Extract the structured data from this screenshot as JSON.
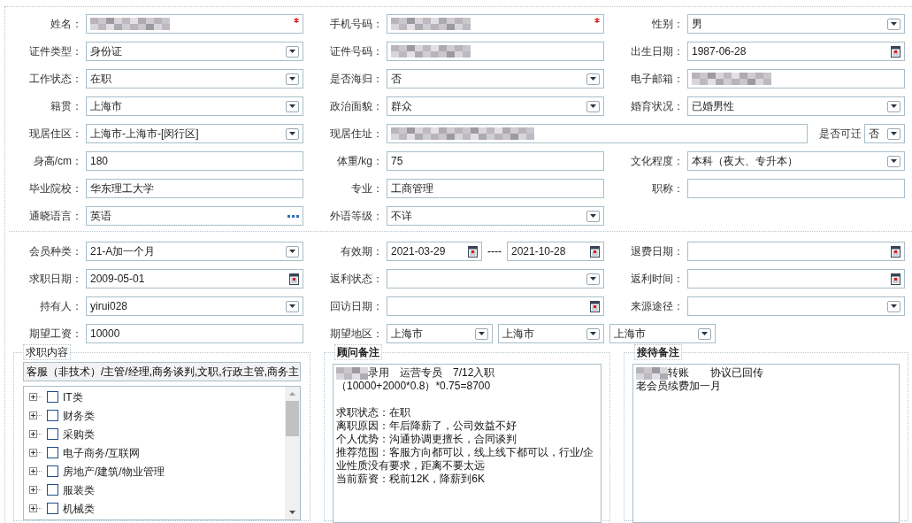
{
  "personal": {
    "rows": [
      {
        "fields": [
          {
            "label": "姓名：",
            "kind": "text",
            "redacted": true,
            "required": true
          },
          {
            "label": "手机号码：",
            "kind": "text",
            "redacted": true,
            "required": true
          },
          {
            "label": "性别：",
            "kind": "select",
            "value": "男"
          }
        ]
      },
      {
        "fields": [
          {
            "label": "证件类型：",
            "kind": "select",
            "value": "身份证"
          },
          {
            "label": "证件号码：",
            "kind": "text",
            "redacted": true
          },
          {
            "label": "出生日期：",
            "kind": "date",
            "value": "1987-06-28"
          }
        ]
      },
      {
        "fields": [
          {
            "label": "工作状态：",
            "kind": "select",
            "value": "在职"
          },
          {
            "label": "是否海归：",
            "kind": "select",
            "value": "否"
          },
          {
            "label": "电子邮箱：",
            "kind": "text",
            "redacted": true
          }
        ]
      },
      {
        "fields": [
          {
            "label": "籍贯：",
            "kind": "select",
            "value": "上海市"
          },
          {
            "label": "政治面貌：",
            "kind": "select",
            "value": "群众"
          },
          {
            "label": "婚育状况：",
            "kind": "select",
            "value": "已婚男性"
          }
        ]
      },
      {
        "fields": [
          {
            "label": "现居住区：",
            "kind": "select",
            "value": " 上海市-上海市-[闵行区]"
          },
          {
            "label": "现居住址：",
            "kind": "text",
            "redacted": true,
            "wide": true,
            "extra": {
              "label": "是否可迁",
              "value": "否"
            }
          }
        ]
      },
      {
        "fields": [
          {
            "label": "身高/cm：",
            "kind": "text",
            "value": "180"
          },
          {
            "label": "体重/kg：",
            "kind": "text",
            "value": "75"
          },
          {
            "label": "文化程度：",
            "kind": "select",
            "value": "本科（夜大、专升本）"
          }
        ]
      },
      {
        "fields": [
          {
            "label": "毕业院校：",
            "kind": "text",
            "value": "华东理工大学"
          },
          {
            "label": "专业：",
            "kind": "text",
            "value": "工商管理"
          },
          {
            "label": "职称：",
            "kind": "text"
          }
        ]
      },
      {
        "fields": [
          {
            "label": "通晓语言：",
            "kind": "picker",
            "value": "英语"
          },
          {
            "label": "外语等级：",
            "kind": "select",
            "value": "不详"
          }
        ]
      }
    ]
  },
  "membership": {
    "rows": [
      {
        "fields": [
          {
            "label": "会员种类：",
            "kind": "select",
            "value": " 21-A加一个月"
          },
          {
            "label": "有效期：",
            "kind": "range",
            "from": "2021-03-29",
            "separator": "----",
            "to": "2021-10-28"
          },
          {
            "label": "退费日期：",
            "kind": "date"
          }
        ]
      },
      {
        "fields": [
          {
            "label": "求职日期：",
            "kind": "date",
            "value": "2009-05-01"
          },
          {
            "label": "返利状态：",
            "kind": "select"
          },
          {
            "label": "返利时间：",
            "kind": "date"
          }
        ]
      },
      {
        "fields": [
          {
            "label": "持有人：",
            "kind": "select",
            "value": "yirui028"
          },
          {
            "label": "回访日期：",
            "kind": "date"
          },
          {
            "label": "来源途径：",
            "kind": "select"
          }
        ]
      },
      {
        "fields": [
          {
            "label": "期望工资：",
            "kind": "text",
            "value": "10000"
          },
          {
            "label": "期望地区：",
            "kind": "multi",
            "values": [
              "上海市",
              "上海市",
              "上海市"
            ]
          }
        ]
      }
    ]
  },
  "job_content": {
    "title": "求职内容",
    "summary": "客服（非技术）/主管/经理,商务谈判,文职,行政主管,商务主",
    "tree": [
      {
        "label": "IT类",
        "checked": false,
        "expanded": false
      },
      {
        "label": "财务类",
        "checked": false,
        "expanded": false
      },
      {
        "label": "采购类",
        "checked": false,
        "expanded": false
      },
      {
        "label": "电子商务/互联网",
        "checked": false,
        "expanded": false
      },
      {
        "label": "房地产/建筑/物业管理",
        "checked": false,
        "expanded": false
      },
      {
        "label": "服装类",
        "checked": false,
        "expanded": false
      },
      {
        "label": "机械类",
        "checked": false,
        "expanded": false
      }
    ]
  },
  "consultant_notes": {
    "title": "顾问备注",
    "lines": [
      {
        "kind": "text",
        "text": "录用　运营专员　7/12入职",
        "redacted_prefix": true
      },
      {
        "kind": "text",
        "text": "（10000+2000*0.8）*0.75=8700"
      },
      {
        "kind": "blank"
      },
      {
        "kind": "text",
        "text": "求职状态：在职"
      },
      {
        "kind": "text",
        "text": "离职原因：年后降薪了，公司效益不好"
      },
      {
        "kind": "text",
        "text": "个人优势：沟通协调更擅长，合同谈判"
      },
      {
        "kind": "text",
        "text": "推荐范围：客服方向都可以，线上线下都可以，行业/企业性质没有要求，距离不要太远"
      },
      {
        "kind": "text",
        "text": "当前薪资：税前12K，降薪到6K"
      }
    ]
  },
  "reception_notes": {
    "title": "接待备注",
    "lines": [
      {
        "kind": "text",
        "text": "转账　　协议已回传",
        "redacted_prefix": true
      },
      {
        "kind": "text",
        "text": "老会员续费加一月"
      }
    ]
  }
}
